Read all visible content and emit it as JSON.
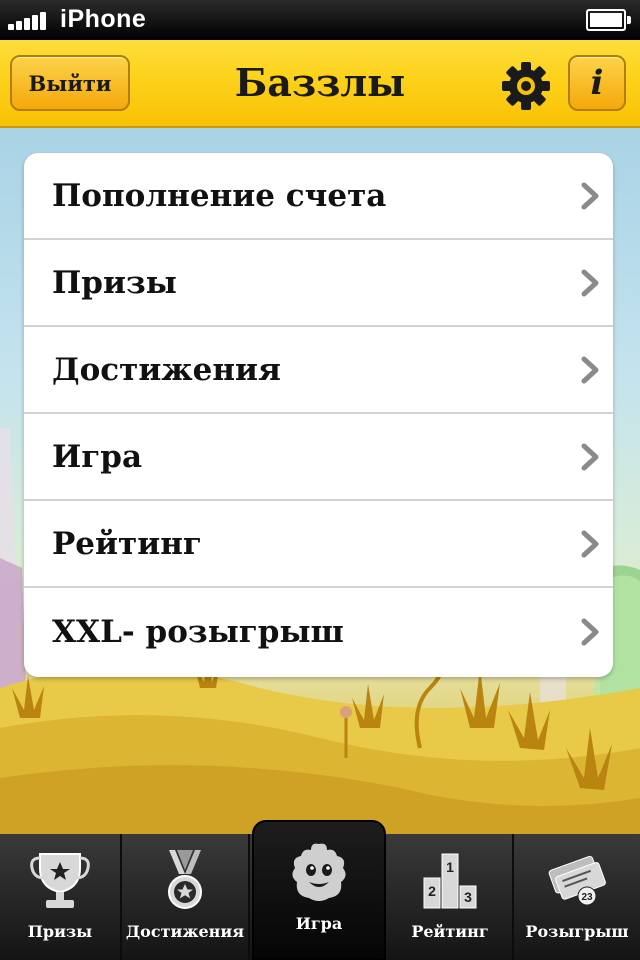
{
  "status_bar": {
    "carrier": "iPhone"
  },
  "nav_bar": {
    "exit_label": "Выйти",
    "title": "Баззлы",
    "info_label": "i"
  },
  "menu": {
    "items": [
      {
        "label": "Пополнение счета"
      },
      {
        "label": "Призы"
      },
      {
        "label": "Достижения"
      },
      {
        "label": "Игра"
      },
      {
        "label": "Рейтинг"
      },
      {
        "label": "XXL- розыгрыш"
      }
    ]
  },
  "tab_bar": {
    "tabs": [
      {
        "label": "Призы",
        "icon": "trophy-icon"
      },
      {
        "label": "Достижения",
        "icon": "medal-icon"
      },
      {
        "label": "Игра",
        "icon": "buzzle-monster-icon",
        "active": true
      },
      {
        "label": "Рейтинг",
        "icon": "podium-icon",
        "podium_numbers": [
          "1",
          "2",
          "3"
        ]
      },
      {
        "label": "Розыгрыш",
        "icon": "tickets-icon",
        "ticket_number": "23"
      }
    ]
  },
  "colors": {
    "nav_yellow": "#fcd11a",
    "button_orange": "#f5a80a",
    "chevron_gray": "#8a8a8a",
    "tabbar_dark": "#1a1a1a"
  }
}
